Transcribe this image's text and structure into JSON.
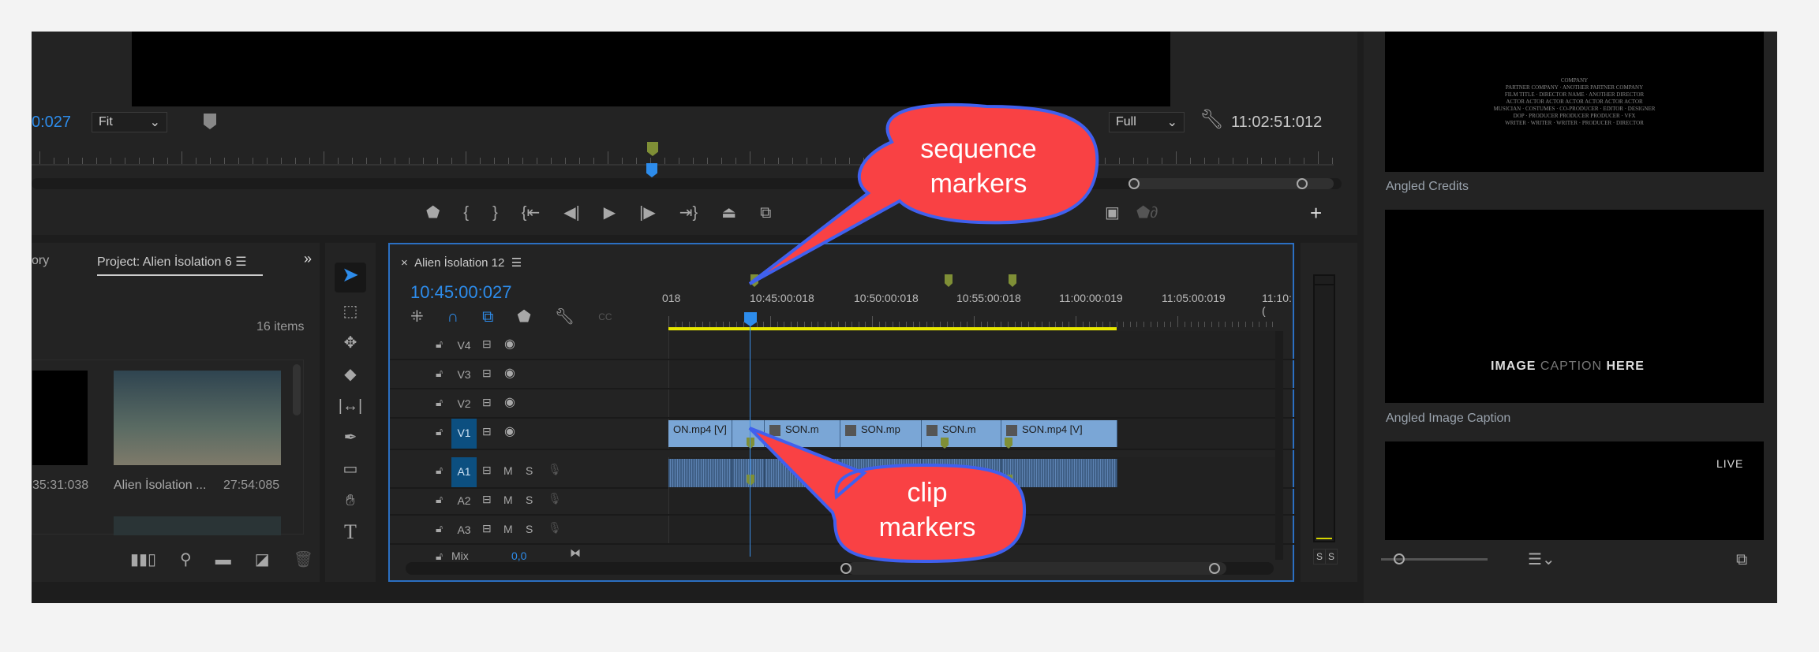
{
  "program_monitor": {
    "timecode": "0:027",
    "fit": "Fit",
    "quality": "Full",
    "duration": "11:02:51:012"
  },
  "project": {
    "tab_partial": "ory",
    "tab": "Project: Alien İsolation 6",
    "count": "16 items",
    "items": [
      {
        "name": "",
        "duration": "35:31:038"
      },
      {
        "name": "Alien İsolation ...",
        "duration": "27:54:085"
      }
    ]
  },
  "timeline": {
    "title": "Alien İsolation 12",
    "timecode": "10:45:00:027",
    "ruler": [
      "018",
      "10:45:00:018",
      "10:50:00:018",
      "10:55:00:018",
      "11:00:00:019",
      "11:05:00:019",
      "11:10:("
    ],
    "video_tracks": [
      "V4",
      "V3",
      "V2",
      "V1"
    ],
    "audio_tracks": [
      "A1",
      "A2",
      "A3"
    ],
    "mute": "M",
    "solo": "S",
    "mix_label": "Mix",
    "mix_value": "0,0",
    "clips": [
      "ON.mp4 [V]",
      "",
      "SON.m",
      "SON.mp",
      "SON.m",
      "SON.mp4 [V]"
    ]
  },
  "meter": {
    "solo_left": "S",
    "solo_right": "S"
  },
  "graphics": {
    "items": [
      {
        "title": "Angled Credits"
      },
      {
        "title": "Angled Image Caption",
        "caption_a": "IMAGE",
        "caption_b": "CAPTION",
        "caption_c": "HERE"
      },
      {
        "title": "",
        "badge": "LIVE"
      }
    ],
    "credits_text": [
      "COMPANY",
      "PARTNER COMPANY · ANOTHER PARTNER COMPANY",
      "FILM TITLE · DIRECTOR NAME · ANOTHER DIRECTOR",
      "ACTOR ACTOR ACTOR ACTOR ACTOR ACTOR ACTOR",
      "MUSICIAN · COSTUMES · CO-PRODUCER · EDITOR · DESIGNER",
      "DOP · PRODUCER PRODUCER PRODUCER · VFX",
      "WRITER · WRITER · WRITER · PRODUCER · DIRECTOR"
    ]
  },
  "annotations": {
    "sequence": [
      "sequence",
      "markers"
    ],
    "clip": [
      "clip",
      "markers"
    ]
  },
  "colors": {
    "accent": "#2d8ceb",
    "marker": "#7f8f36",
    "clip_video": "#7aa6d6",
    "callout": "#f94144",
    "callout_border": "#4060ee"
  }
}
